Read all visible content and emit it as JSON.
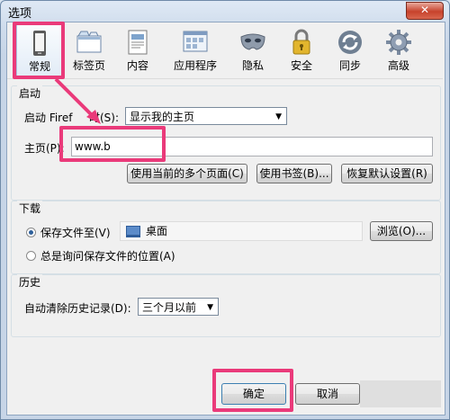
{
  "window": {
    "title": "选项",
    "close_symbol": "✕"
  },
  "toolbar": {
    "items": [
      {
        "label": "常规",
        "icon": "phone-device-icon",
        "selected": true
      },
      {
        "label": "标签页",
        "icon": "tabs-window-icon"
      },
      {
        "label": "内容",
        "icon": "page-content-icon"
      },
      {
        "label": "应用程序",
        "icon": "applications-window-icon"
      },
      {
        "label": "隐私",
        "icon": "privacy-mask-icon"
      },
      {
        "label": "安全",
        "icon": "security-padlock-icon"
      },
      {
        "label": "同步",
        "icon": "sync-arrows-icon"
      },
      {
        "label": "高级",
        "icon": "advanced-gear-icon"
      }
    ]
  },
  "startup": {
    "legend": "启动",
    "when_label_a": "启动 Firef",
    "when_label_b": "时(S):",
    "when_value": "显示我的主页",
    "homepage_label": "主页(P):",
    "homepage_value": "www.b",
    "btn_current_pages": "使用当前的多个页面(C)",
    "btn_bookmark": "使用书签(B)...",
    "btn_restore_default": "恢复默认设置(R)"
  },
  "downloads": {
    "legend": "下载",
    "save_to_label": "保存文件至(V)",
    "folder_name": "桌面",
    "browse_button": "浏览(O)...",
    "always_ask_label": "总是询问保存文件的位置(A)"
  },
  "history": {
    "legend": "历史",
    "clear_label": "自动清除历史记录(D):",
    "clear_value": "三个月以前"
  },
  "footer": {
    "ok_button": "确定",
    "cancel_button": "取消"
  },
  "colors": {
    "annotation": "#ea3a7a",
    "window_frame": "#6f8aa8",
    "close_button": "#c7422c"
  }
}
